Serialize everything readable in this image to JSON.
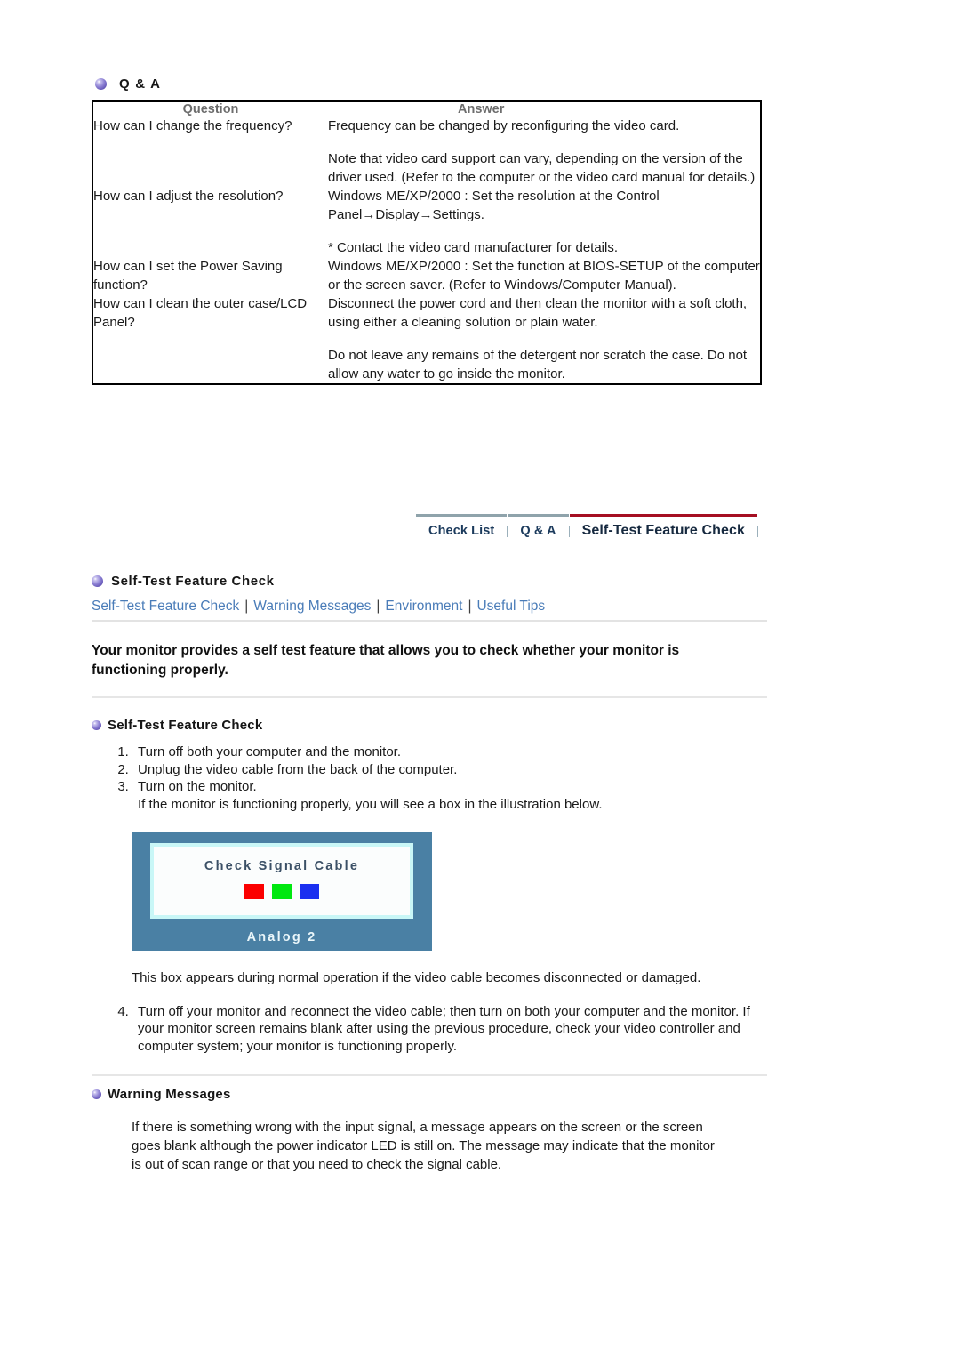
{
  "qa": {
    "heading": "Q & A",
    "bullet_icon": "bullet-sphere-icon",
    "columns": {
      "question": "Question",
      "answer": "Answer"
    },
    "rows": [
      {
        "question": "How can I change the frequency?",
        "answer_paragraphs": [
          "Frequency can be changed by reconfiguring the video card.",
          "Note that video card support can vary, depending on the version of the driver used. (Refer to the computer or the video card manual for details.)"
        ]
      },
      {
        "question": "How can I adjust the resolution?",
        "answer_paragraphs": [
          "Windows ME/XP/2000 : Set the resolution at the Control Panel→Display→Settings.",
          "* Contact the video card manufacturer for details."
        ]
      },
      {
        "question": "How can I set the Power Saving function?",
        "answer_paragraphs": [
          "Windows ME/XP/2000 : Set the function at BIOS-SETUP of the computer or the screen saver. (Refer to Windows/Computer Manual)."
        ]
      },
      {
        "question": "How can I clean the outer case/LCD Panel?",
        "answer_paragraphs": [
          "Disconnect the power cord and then clean the monitor with a soft cloth, using either a cleaning solution or plain water.",
          "Do not leave any remains of the detergent nor scratch the case. Do not allow any water to go inside the monitor."
        ]
      }
    ]
  },
  "tabstrip": {
    "tabs": [
      {
        "label": "Check List",
        "active": false
      },
      {
        "label": "Q & A",
        "active": false
      },
      {
        "label": "Self-Test Feature Check",
        "active": true
      }
    ],
    "active_underline_color": "#a50f22",
    "inactive_underline_color": "#8fa3ab"
  },
  "selftest": {
    "bullet_icon": "bullet-sphere-icon",
    "heading": "Self-Test Feature Check",
    "subnav": [
      "Self-Test Feature Check",
      "Warning Messages",
      "Environment",
      "Useful Tips"
    ],
    "subnav_separator": "|",
    "subnav_link_color": "#4a7cb8",
    "lead": "Your monitor provides a self test feature that allows you to check whether your monitor is functioning properly.",
    "sub_heading": "Self-Test Feature Check",
    "steps": [
      {
        "text": "Turn off both your computer and the monitor.",
        "extra": ""
      },
      {
        "text": "Unplug the video cable from the back of the computer.",
        "extra": ""
      },
      {
        "text": "Turn on the monitor.",
        "extra": "If the monitor is functioning properly, you will see a box in the illustration below."
      }
    ],
    "monitor": {
      "message": "Check Signal Cable",
      "input_label": "Analog 2",
      "bezel_color": "#4a80a4",
      "inner_border_color": "#c9f7f7",
      "screen_color": "#fbfdfd",
      "swatch_colors": [
        "#fb0000",
        "#00e810",
        "#1a2ff0"
      ]
    },
    "after_image_paragraph": "This box appears during normal operation if the video cable becomes disconnected or damaged.",
    "steps_continued": [
      {
        "number": "4.",
        "text": "Turn off your monitor and reconnect the video cable; then turn on both your computer and the monitor.",
        "extra": "If your monitor screen remains blank after using the previous procedure, check your video controller and computer system; your monitor is functioning properly."
      }
    ]
  },
  "warning": {
    "bullet_icon": "bullet-sphere-icon",
    "heading": "Warning Messages",
    "body": "If there is something wrong with the input signal, a message appears on the screen or the screen goes blank although the power indicator LED is still on. The message may indicate that the monitor is out of scan range or that you need to check the signal cable."
  }
}
